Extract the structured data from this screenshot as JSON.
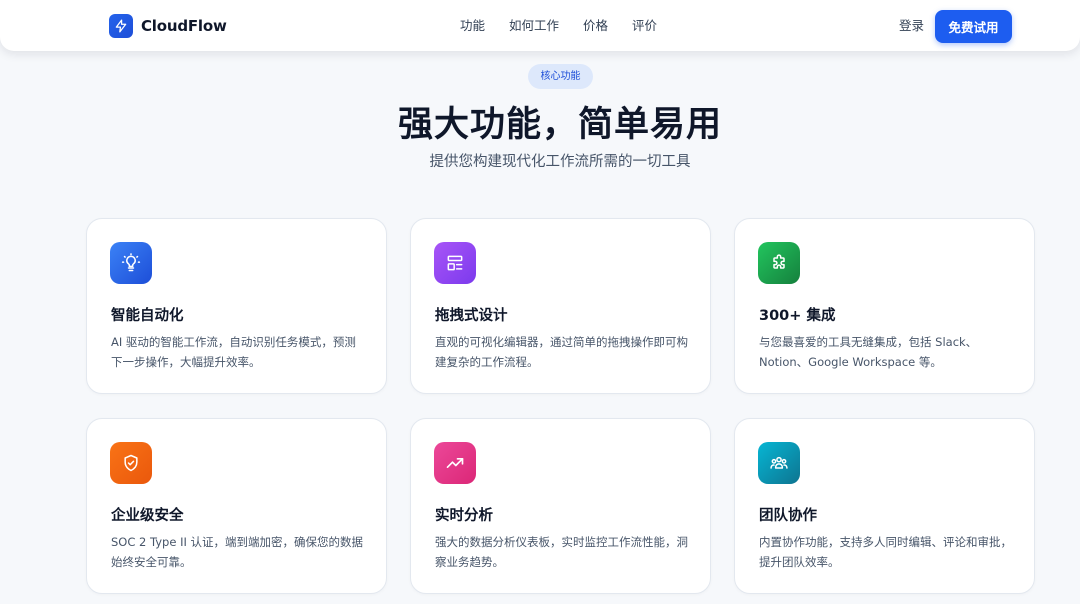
{
  "brand": {
    "name": "CloudFlow",
    "icon": "lightning-icon",
    "color": "#1d5df0"
  },
  "nav": {
    "links": [
      "功能",
      "如何工作",
      "价格",
      "评价"
    ],
    "login_label": "登录",
    "trial_label": "免费试用"
  },
  "hero": {
    "badge": "核心功能",
    "title": "强大功能，简单易用",
    "subtitle": "提供您构建现代化工作流所需的一切工具"
  },
  "features": [
    {
      "title": "智能自动化",
      "description": "AI 驱动的智能工作流，自动识别任务模式，预测下一步操作，大幅提升效率。",
      "icon": "lightbulb-icon",
      "color_from": "#3b82f6",
      "color_to": "#1d4ed8"
    },
    {
      "title": "拖拽式设计",
      "description": "直观的可视化编辑器，通过简单的拖拽操作即可构建复杂的工作流程。",
      "icon": "layout-icon",
      "color_from": "#a855f7",
      "color_to": "#7c3aed"
    },
    {
      "title": "300+ 集成",
      "description": "与您最喜爱的工具无缝集成，包括 Slack、Notion、Google Workspace 等。",
      "icon": "puzzle-icon",
      "color_from": "#22c55e",
      "color_to": "#15803d"
    },
    {
      "title": "企业级安全",
      "description": "SOC 2 Type II 认证，端到端加密，确保您的数据始终安全可靠。",
      "icon": "shield-check-icon",
      "color_from": "#f97316",
      "color_to": "#ea580c"
    },
    {
      "title": "实时分析",
      "description": "强大的数据分析仪表板，实时监控工作流性能，洞察业务趋势。",
      "icon": "trending-up-icon",
      "color_from": "#ec4899",
      "color_to": "#db2777"
    },
    {
      "title": "团队协作",
      "description": "内置协作功能，支持多人同时编辑、评论和审批，提升团队效率。",
      "icon": "team-icon",
      "color_from": "#06b6d4",
      "color_to": "#0e7490"
    }
  ]
}
